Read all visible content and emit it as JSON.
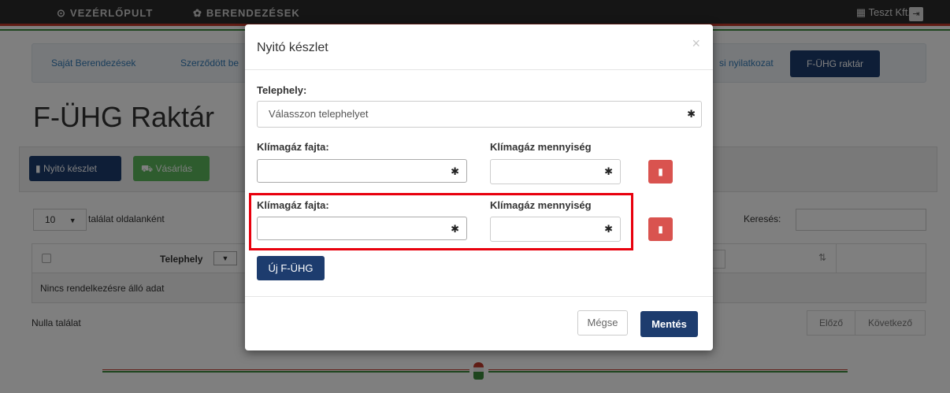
{
  "navbar": {
    "dashboard_label": "VEZÉRLŐPULT",
    "dashboard_icon": "dashboard-icon",
    "equipment_label": "BERENDEZÉSEK",
    "equipment_icon": "gear-icon",
    "company": "Teszt Kft.",
    "company_icon": "building-icon",
    "logout_icon": "logout-icon"
  },
  "subnav": {
    "items": [
      "Saját Berendezések",
      "Szerződött be",
      "si nyilatkozat"
    ],
    "active": "F-ÜHG raktár"
  },
  "page": {
    "title": "F-ÜHG Raktár",
    "open_stock_button": "Nyitó készlet",
    "purchase_button": "Vásárlás",
    "per_page_value": "10",
    "per_page_label": "találat oldalanként",
    "search_label": "Keresés:",
    "column_site": "Telephely",
    "empty_message": "Nincs rendelkezésre álló adat",
    "zero_results": "Nulla találat",
    "prev_button": "Előző",
    "next_button": "Következő"
  },
  "modal": {
    "title": "Nyitó készlet",
    "close_glyph": "×",
    "site_label": "Telephely:",
    "site_placeholder": "Válasszon telephelyet",
    "rows": [
      {
        "type_label": "Klímagáz fajta:",
        "qty_label": "Klímagáz mennyiség",
        "type_value": "",
        "qty_value": ""
      },
      {
        "type_label": "Klímagáz fajta:",
        "qty_label": "Klímagáz mennyiség",
        "type_value": "",
        "qty_value": ""
      }
    ],
    "new_button": "Új F-ÜHG",
    "cancel_button": "Mégse",
    "save_button": "Mentés",
    "highlight_color": "#e8000d"
  },
  "colors": {
    "primary": "#1d3c6e",
    "success": "#5cb85c",
    "danger": "#d9534f"
  }
}
